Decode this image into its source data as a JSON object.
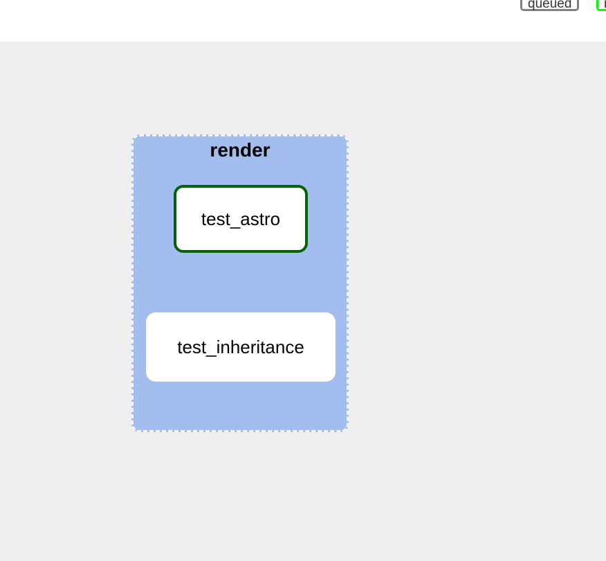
{
  "legend": {
    "queued_label": "queued",
    "running_label": "r"
  },
  "graph": {
    "group": {
      "label": "render",
      "tasks": [
        {
          "label": "test_astro",
          "state_color": "#006400"
        },
        {
          "label": "test_inheritance"
        }
      ]
    }
  },
  "colors": {
    "canvas_background": "#eeeeee",
    "group_fill": "#a2bdee",
    "queued_border": "#808080",
    "running_border": "#00ff00",
    "success_border": "#006400"
  }
}
